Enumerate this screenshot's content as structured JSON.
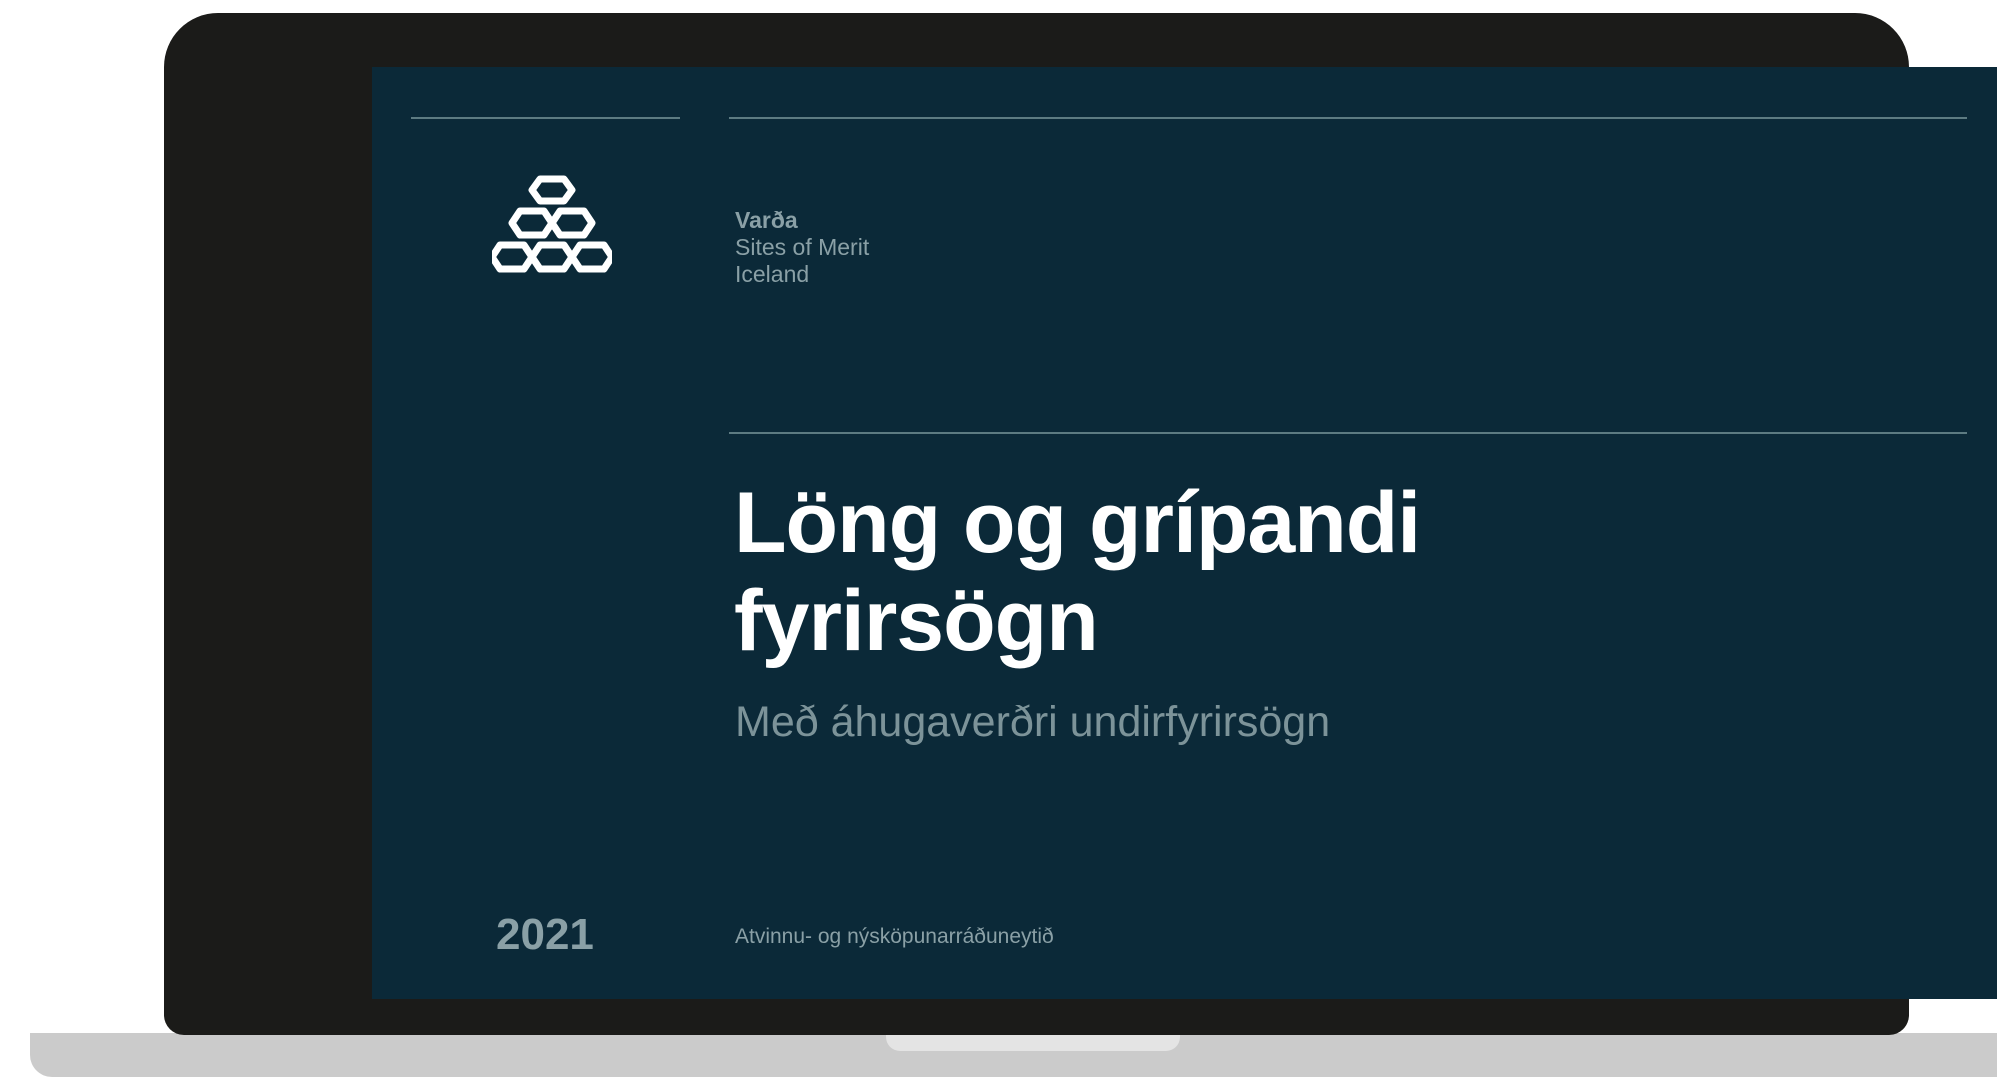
{
  "slide": {
    "brand": {
      "name": "Varða",
      "line1": "Sites of Merit",
      "line2": "Iceland"
    },
    "title_line1": "Löng og grípandi",
    "title_line2": "fyrirsögn",
    "subtitle": "Með áhugaverðri undirfyrirsögn",
    "year": "2021",
    "ministry": "Atvinnu- og nýsköpunarráðuneytið"
  },
  "colors": {
    "screen_background": "#0b2938",
    "bezel": "#1b1b19",
    "headline": "#ffffff",
    "muted_text": "#8aa0a6",
    "rule": "#5d7b82"
  },
  "icons": {
    "logo": "varda-knot-logo-icon"
  }
}
